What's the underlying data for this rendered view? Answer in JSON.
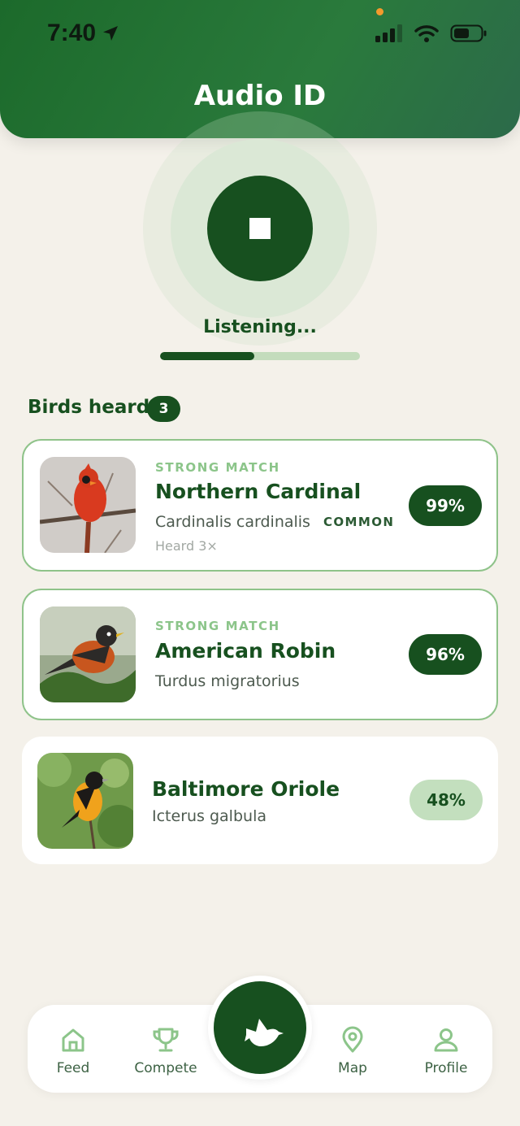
{
  "status_bar": {
    "time": "7:40"
  },
  "header": {
    "title": "Audio ID"
  },
  "listening": {
    "status": "Listening...",
    "progress": 0.47
  },
  "section": {
    "title": "Birds heard",
    "count": "3"
  },
  "birds": [
    {
      "match_label": "STRONG MATCH",
      "common_name": "Northern Cardinal",
      "scientific_name": "Cardinalis cardinalis",
      "rarity": "COMMON",
      "heard": "Heard 3×",
      "confidence": "99%"
    },
    {
      "match_label": "STRONG MATCH",
      "common_name": "American Robin",
      "scientific_name": "Turdus migratorius",
      "confidence": "96%"
    },
    {
      "common_name": "Baltimore Oriole",
      "scientific_name": "Icterus galbula",
      "confidence": "48%"
    }
  ],
  "nav": {
    "feed": "Feed",
    "compete": "Compete",
    "map": "Map",
    "profile": "Profile",
    "center_icon": "bird-icon"
  },
  "colors": {
    "primary": "#17501f",
    "header": "#1c6a2b",
    "accent_light": "#8cc58a",
    "background": "#f4f1ea"
  }
}
